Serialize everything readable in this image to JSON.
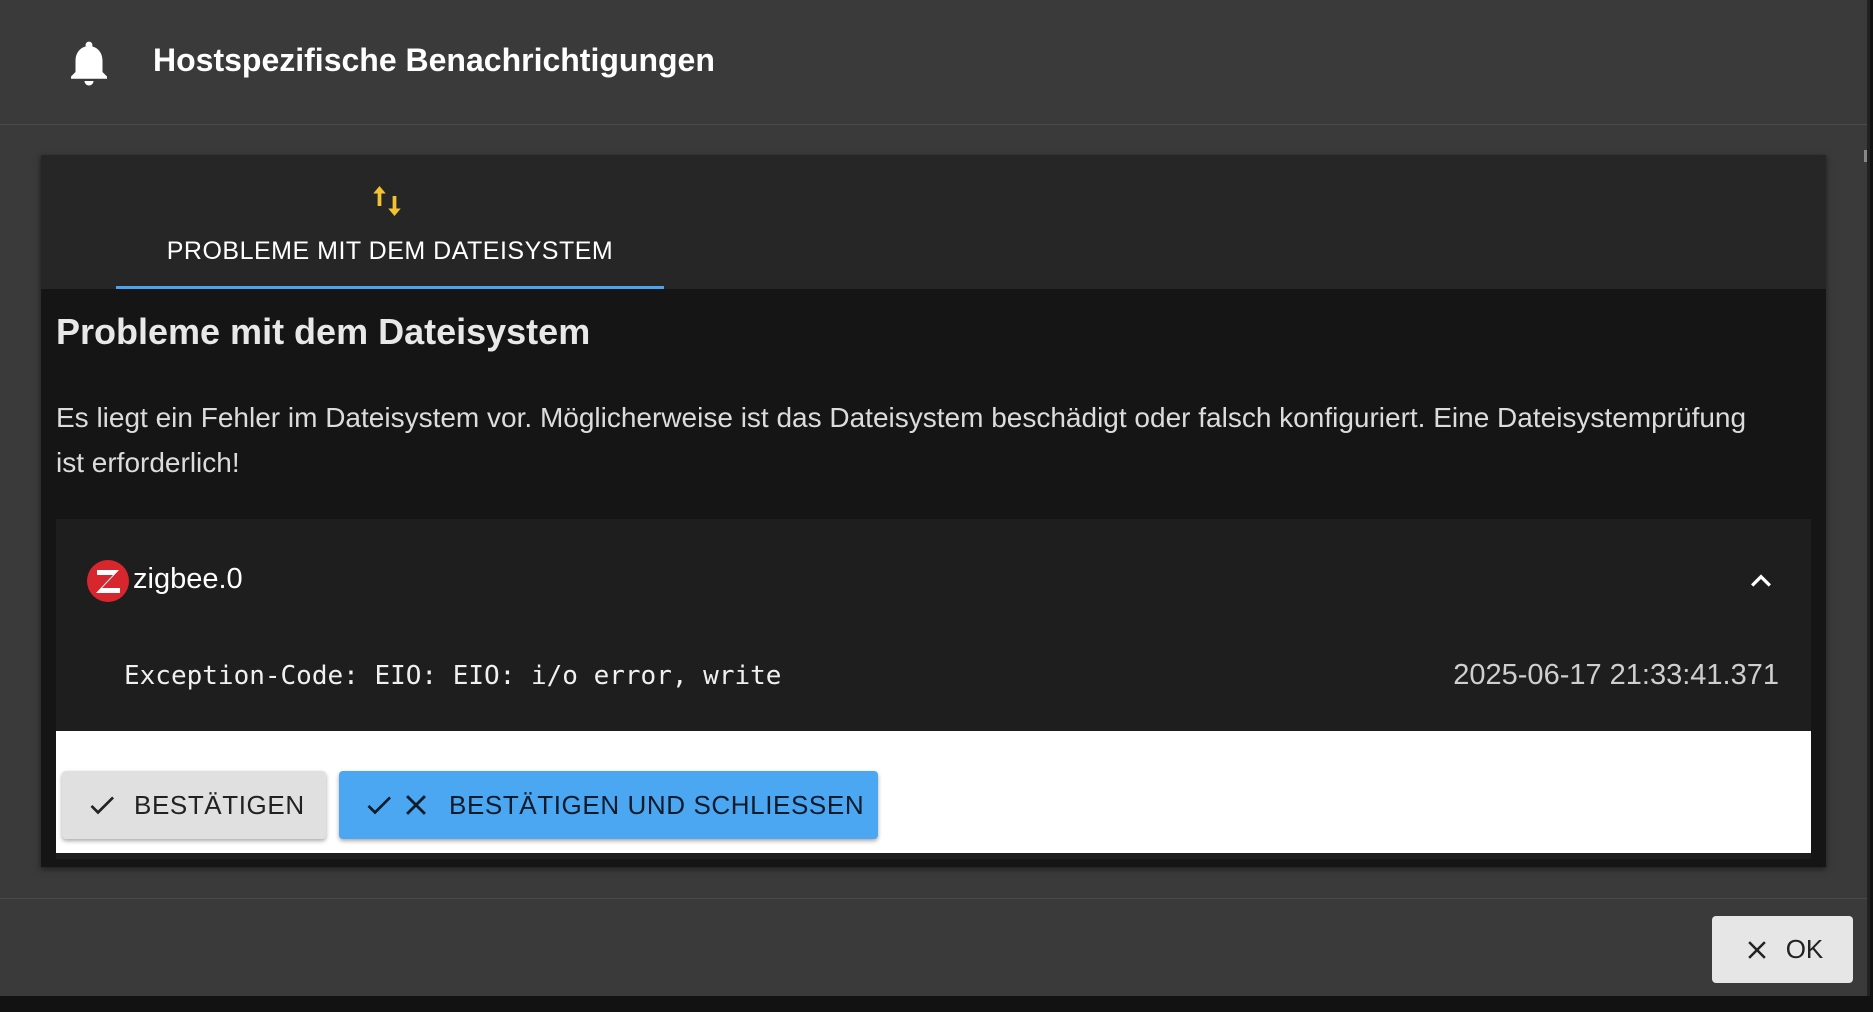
{
  "dialog": {
    "title": "Hostspezifische Benachrichtigungen",
    "icon": "bell-icon"
  },
  "tabs": [
    {
      "label": "PROBLEME MIT DEM DATEISYSTEM",
      "icon": "swap-vertical-icon",
      "active": true,
      "icon_color": "#f2c230"
    }
  ],
  "section": {
    "title": "Probleme mit dem Dateisystem",
    "description": "Es liegt ein Fehler im Dateisystem vor. Möglicherweise ist das Dateisystem beschädigt oder falsch konfiguriert. Eine Dateisystemprüfung ist erforderlich!"
  },
  "message": {
    "adapter": "zigbee.0",
    "adapter_icon": "zigbee-logo",
    "text": "Exception-Code: EIO: EIO: i/o error, write",
    "timestamp": "2025-06-17 21:33:41.371",
    "expanded": true
  },
  "actions": {
    "confirm_label": "BESTÄTIGEN",
    "confirm_close_label": "BESTÄTIGEN UND SCHLIESSEN"
  },
  "footer": {
    "ok_label": "OK"
  },
  "colors": {
    "accent": "#4ba7f2",
    "tab_icon": "#f2c230",
    "zigbee_red": "#d8262e"
  }
}
